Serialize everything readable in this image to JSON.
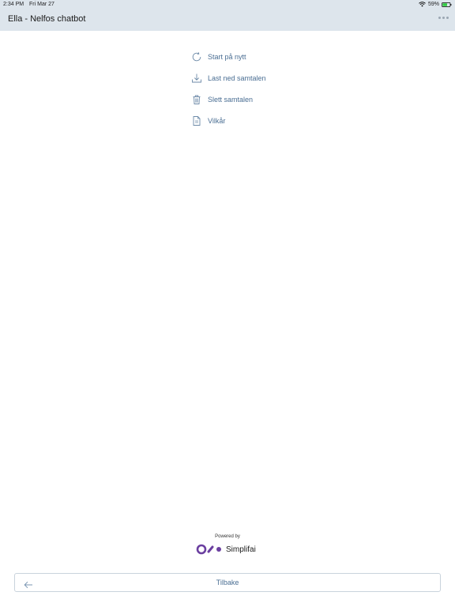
{
  "status_bar": {
    "time": "2:34 PM",
    "date": "Fri Mar 27",
    "battery": "59%"
  },
  "header": {
    "title": "Ella - Nelfos chatbot"
  },
  "menu": {
    "items": [
      {
        "label": "Start på nytt",
        "icon": "refresh-icon"
      },
      {
        "label": "Last ned samtalen",
        "icon": "download-icon"
      },
      {
        "label": "Slett samtalen",
        "icon": "trash-icon"
      },
      {
        "label": "Vilkår",
        "icon": "document-icon"
      }
    ]
  },
  "footer": {
    "powered_by": "Powered by",
    "brand": "Simplifai",
    "back_label": "Tilbake"
  },
  "colors": {
    "header_bg": "#dde5ec",
    "accent": "#4a6e93",
    "brand_purple": "#6b3fa0"
  }
}
